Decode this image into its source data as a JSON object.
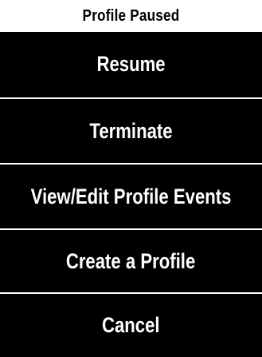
{
  "dialog": {
    "title": "Profile Paused"
  },
  "menu": {
    "items": [
      {
        "label": "Resume"
      },
      {
        "label": "Terminate"
      },
      {
        "label": "View/Edit Profile Events"
      },
      {
        "label": "Create a Profile"
      },
      {
        "label": "Cancel"
      }
    ]
  },
  "colors": {
    "background": "#ffffff",
    "menu_background": "#000000",
    "menu_text": "#ffffff",
    "divider": "#ffffff"
  }
}
